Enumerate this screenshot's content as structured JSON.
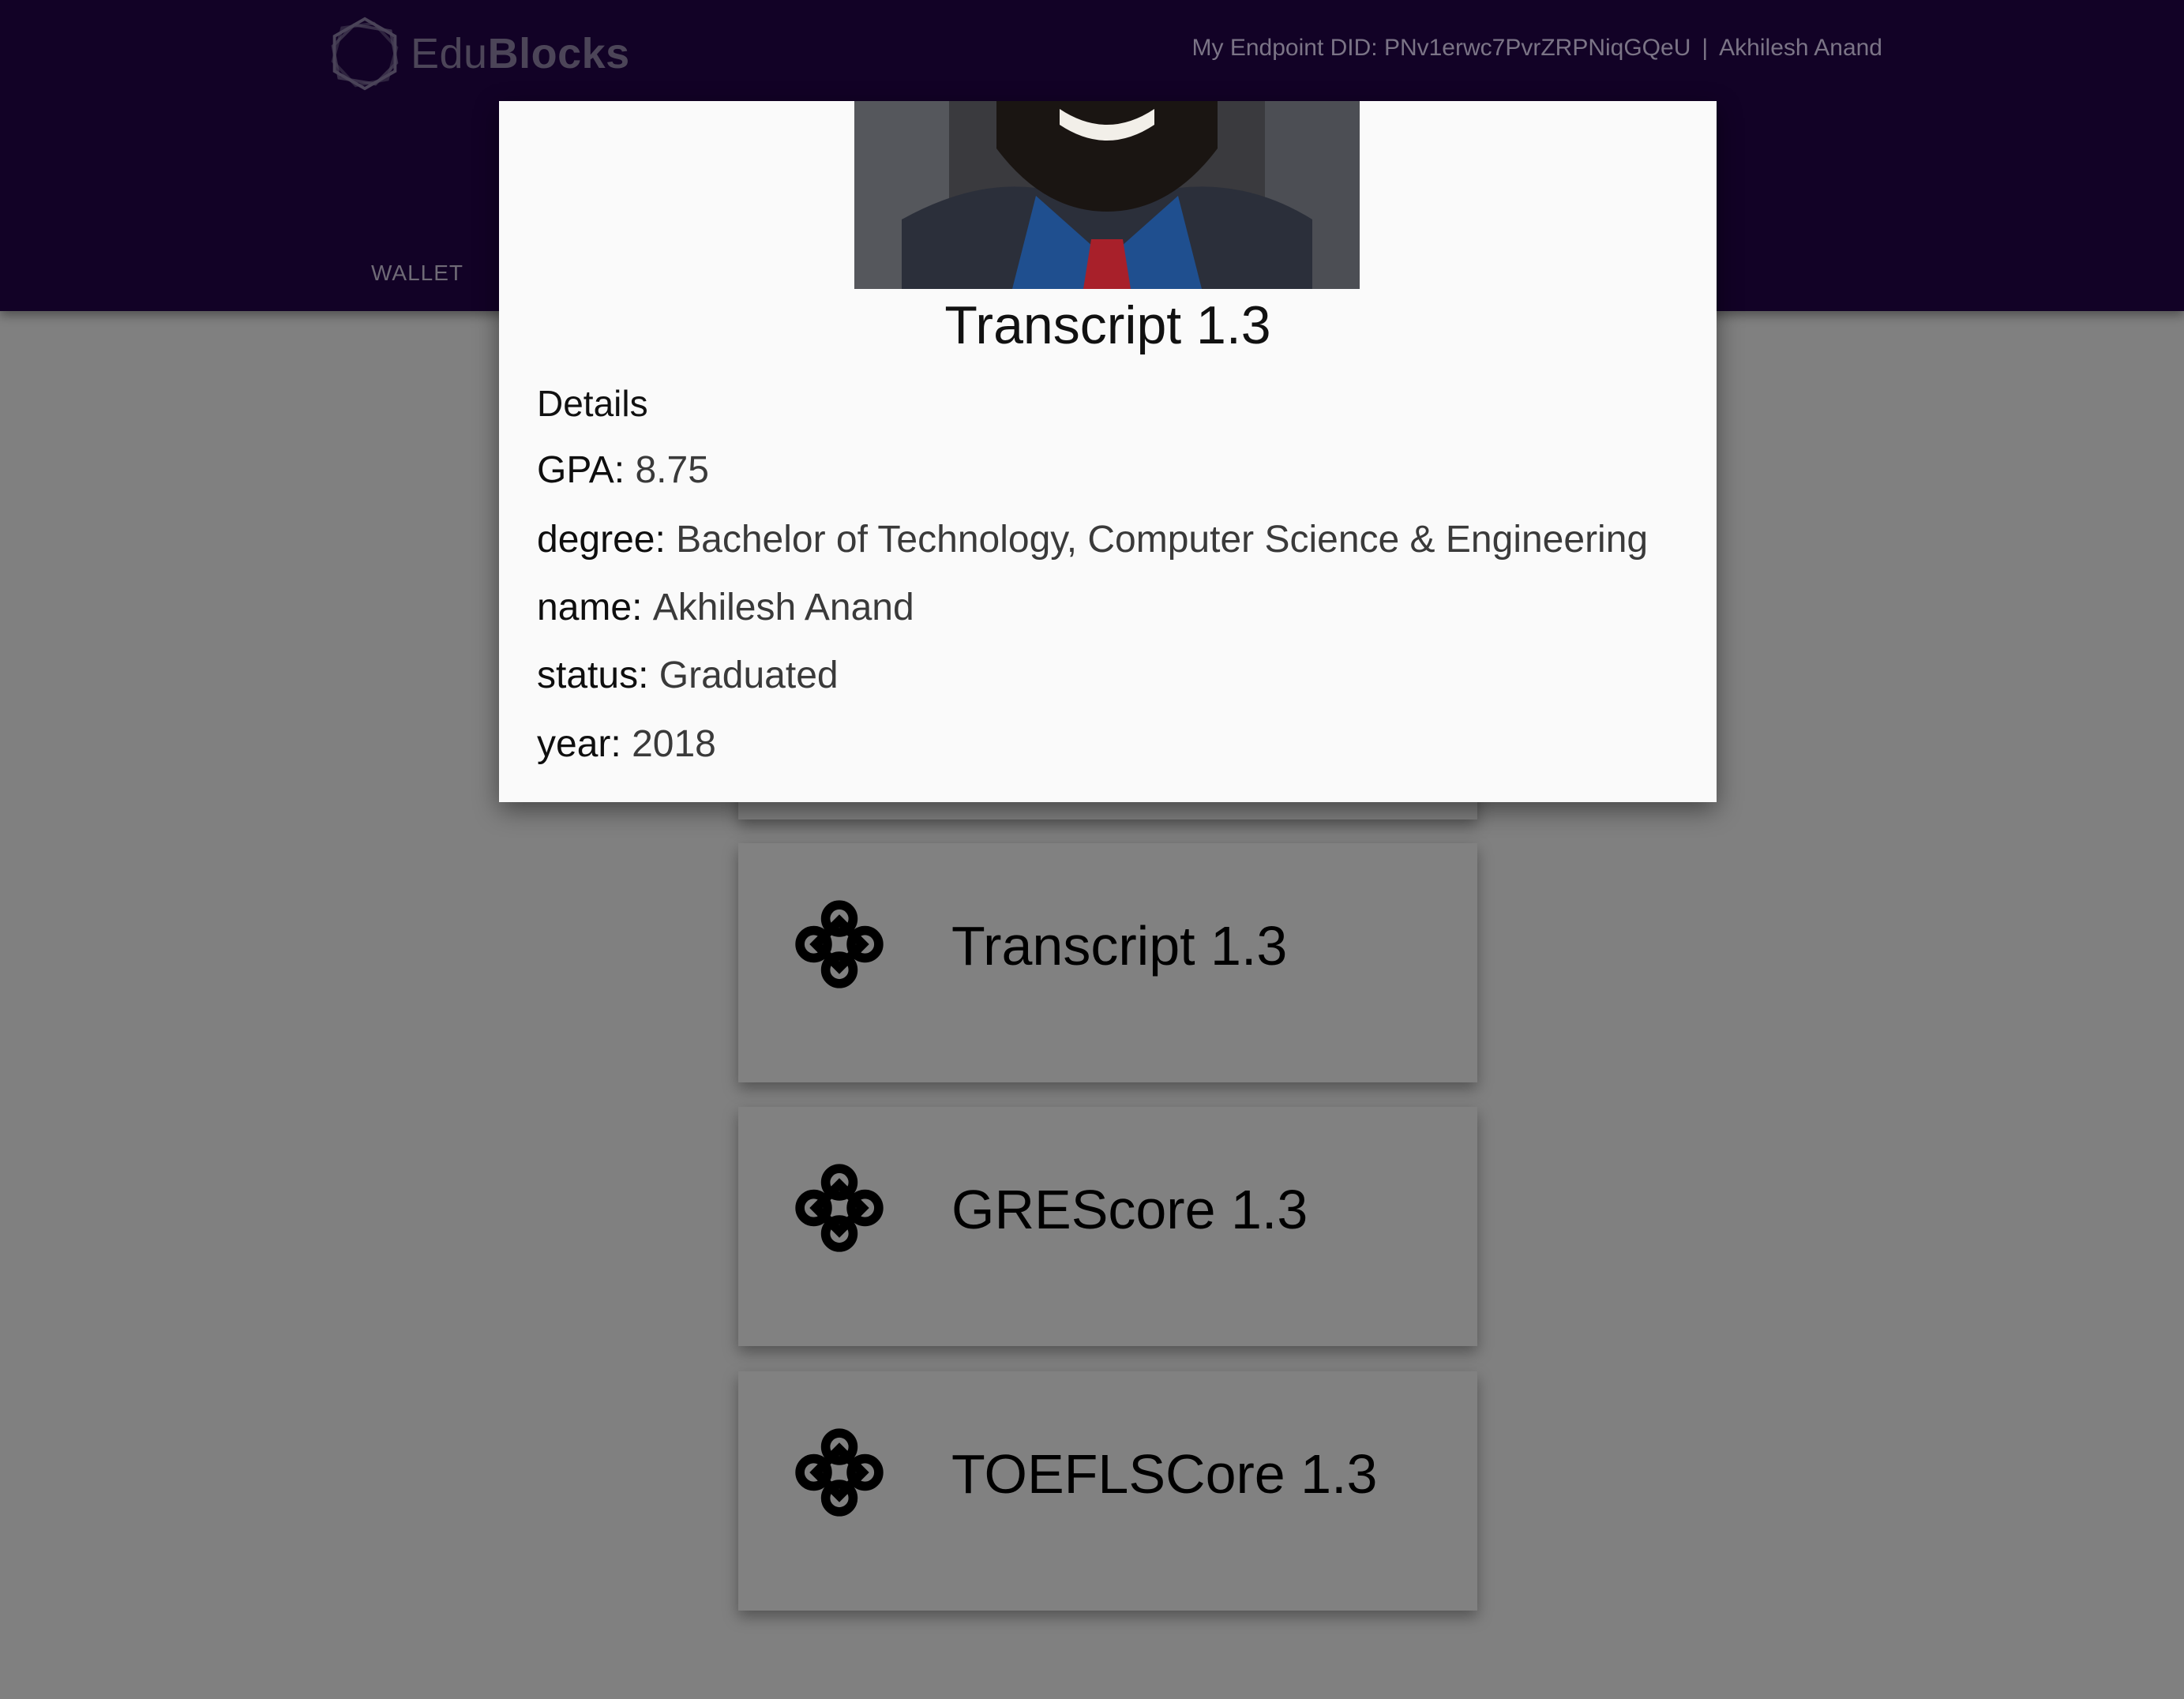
{
  "header": {
    "logo_text_light": "Edu",
    "logo_text_bold": "Blocks",
    "endpoint_label": "My Endpoint DID: PNv1erwc7PvrZRPNiqGQeU",
    "separator": "|",
    "user_name": "Akhilesh Anand",
    "nav_wallet": "WALLET"
  },
  "modal": {
    "title": "Transcript 1.3",
    "details_heading": "Details",
    "fields": [
      {
        "key": "GPA:",
        "value": "8.75"
      },
      {
        "key": "degree:",
        "value": "Bachelor of Technology, Computer Science & Engineering"
      },
      {
        "key": "name:",
        "value": "Akhilesh Anand"
      },
      {
        "key": "status:",
        "value": "Graduated"
      },
      {
        "key": "year:",
        "value": "2018"
      }
    ]
  },
  "cards": [
    {
      "title": "Transcript 1.3",
      "icon": "credential-knot-icon"
    },
    {
      "title": "GREScore 1.3",
      "icon": "credential-knot-icon"
    },
    {
      "title": "TOEFLSCore 1.3",
      "icon": "credential-knot-icon"
    }
  ],
  "colors": {
    "header_bg": "#120226",
    "overlay_bg": "#808080",
    "modal_bg": "#fafafa"
  }
}
